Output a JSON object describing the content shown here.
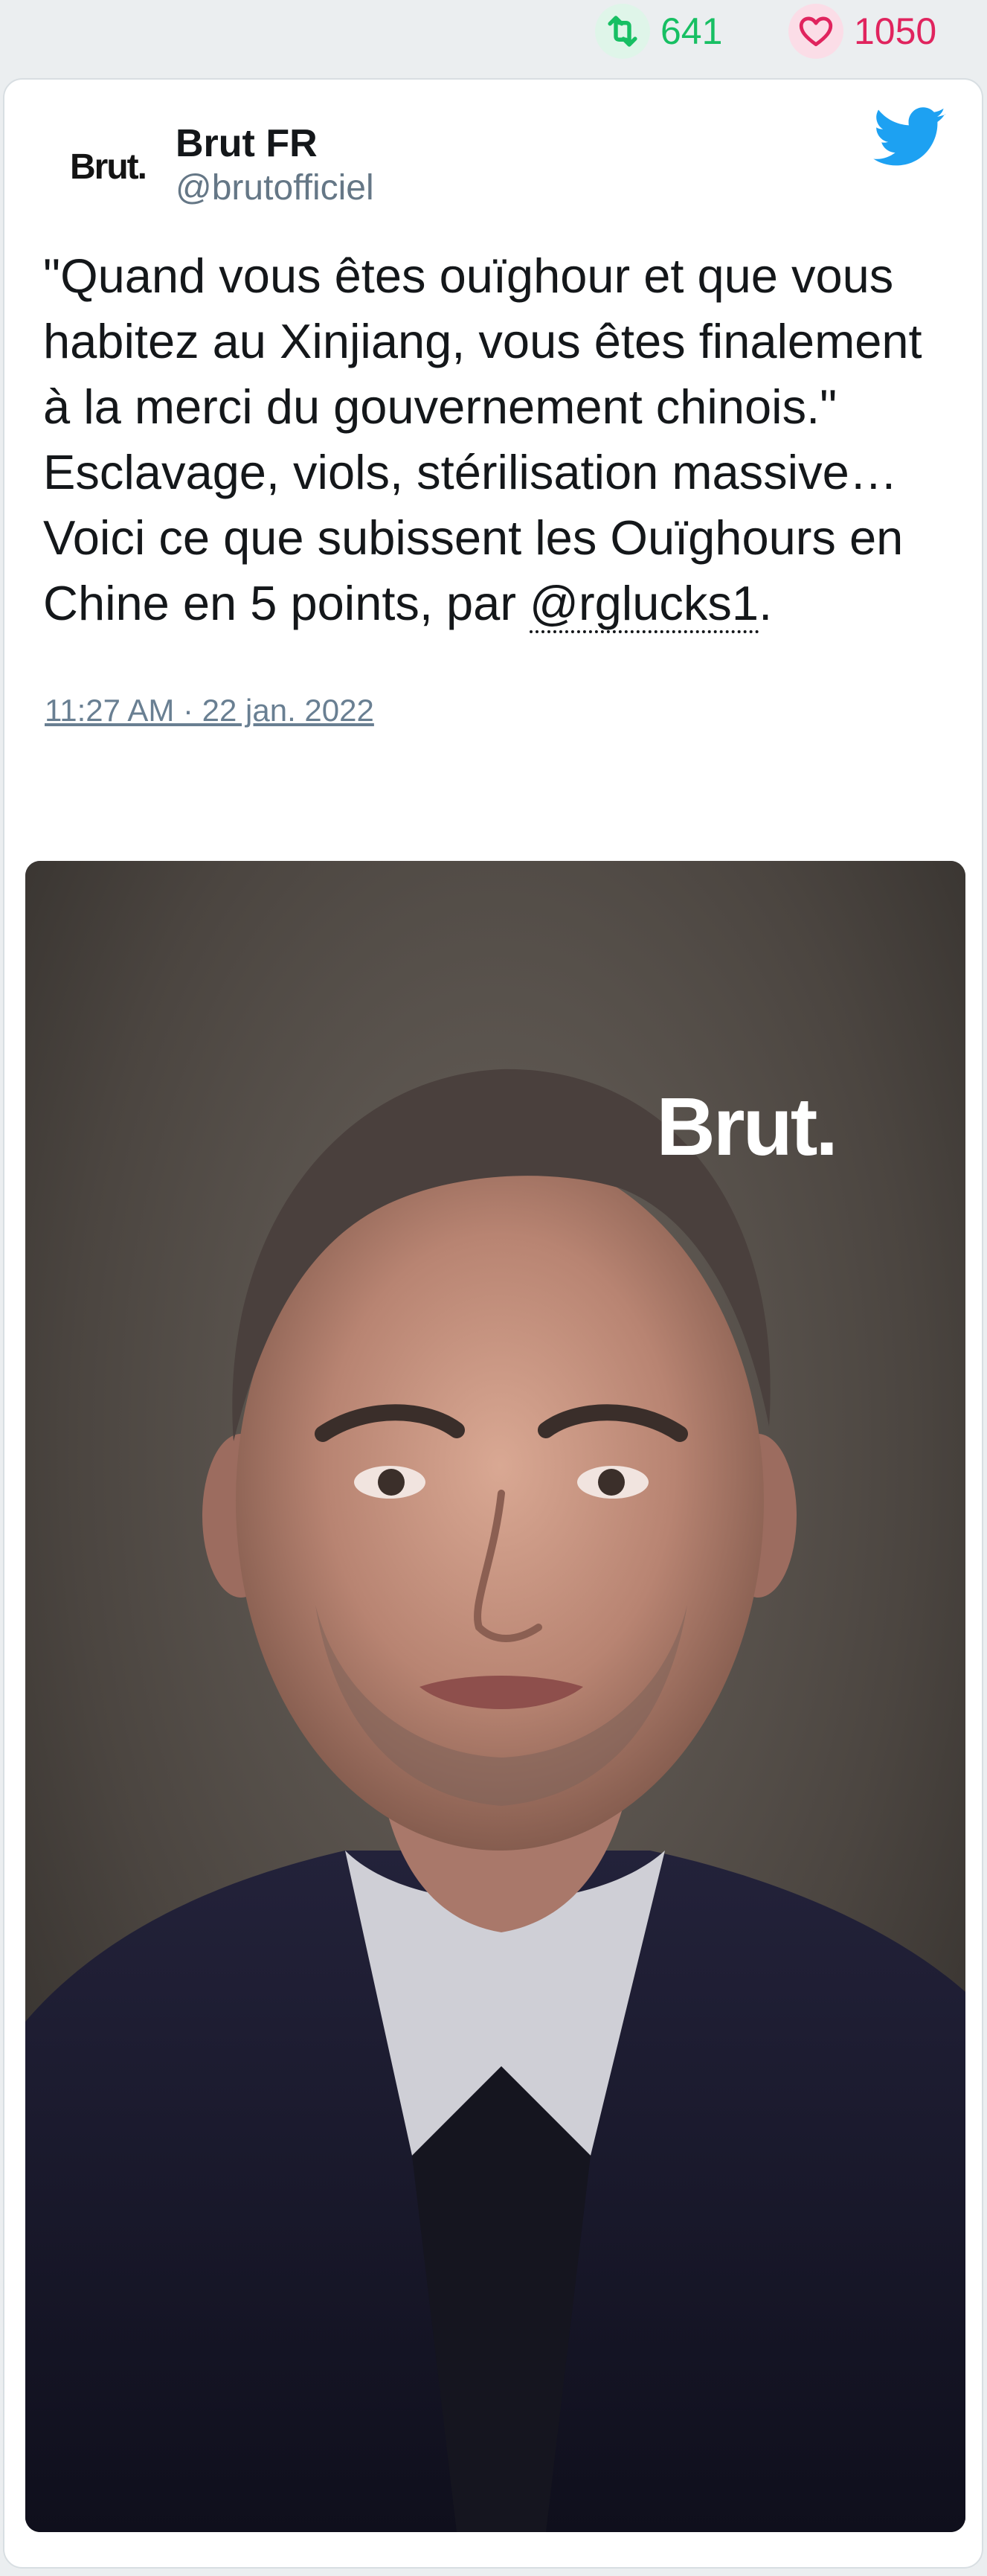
{
  "stats": {
    "retweets": "641",
    "likes": "1050",
    "retweet_icon": "retweet-icon",
    "like_icon": "heart-icon"
  },
  "tweet": {
    "avatar_text": "Brut.",
    "author_name": "Brut FR",
    "author_handle": "@brutofficiel",
    "text_before_mention": "\"Quand vous êtes ouïghour et que vous habitez au Xinjiang, vous êtes finalement à la merci du gouvernement chinois.\" Esclavage, viols, stérilisation massive… Voici ce que subissent les Ouïghours en Chine en 5 points, par ",
    "mention": "@rglucks1",
    "text_after_mention": ".",
    "timestamp": "11:27 AM · 22 jan. 2022",
    "actions": [
      "reply-icon",
      "retweet-icon",
      "heart-icon"
    ]
  },
  "media": {
    "watermark": "Brut.",
    "description_icon": "video-thumbnail"
  },
  "colors": {
    "retweet": "#17bf63",
    "like": "#e0245e",
    "twitter_blue": "#1da1f2",
    "muted": "#657786",
    "background": "#ebeef0"
  }
}
